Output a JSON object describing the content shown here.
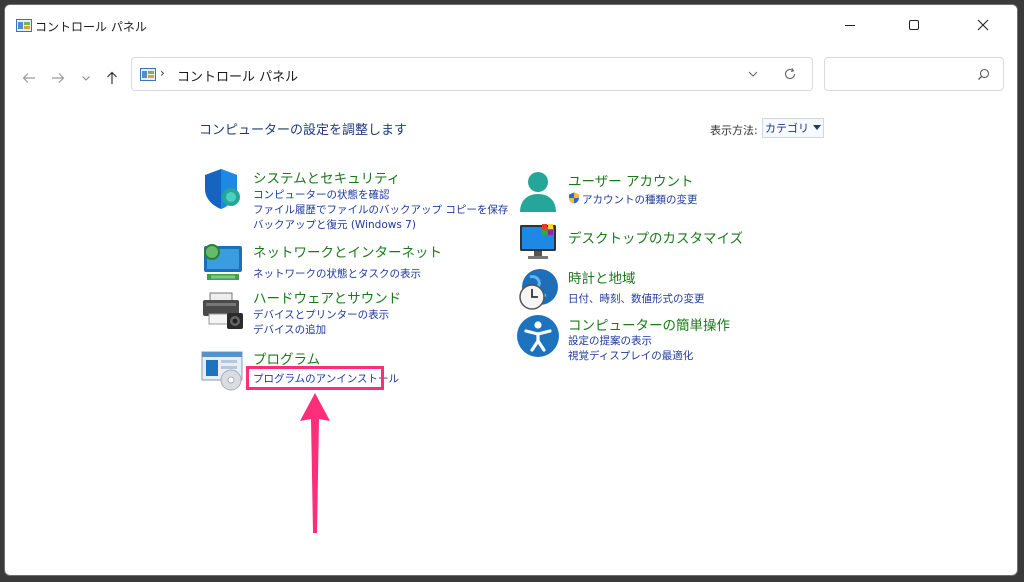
{
  "window": {
    "title": "コントロール パネル",
    "controls": {
      "minimize": "—",
      "maximize": "□",
      "close": "✕"
    }
  },
  "nav": {
    "breadcrumb_sep": "›",
    "address": "コントロール パネル",
    "search_placeholder": ""
  },
  "main": {
    "heading": "コンピューターの設定を調整します",
    "view_by_label": "表示方法:",
    "view_by_value": "カテゴリ"
  },
  "categories": [
    {
      "title": "システムとセキュリティ",
      "links": [
        "コンピューターの状態を確認",
        "ファイル履歴でファイルのバックアップ コピーを保存",
        "バックアップと復元 (Windows 7)"
      ],
      "icon": "shield-icon"
    },
    {
      "title": "ネットワークとインターネット",
      "links": [
        "ネットワークの状態とタスクの表示"
      ],
      "icon": "network-icon"
    },
    {
      "title": "ハードウェアとサウンド",
      "links": [
        "デバイスとプリンターの表示",
        "デバイスの追加"
      ],
      "icon": "printer-icon"
    },
    {
      "title": "プログラム",
      "links": [
        "プログラムのアンインストール"
      ],
      "icon": "programs-icon"
    },
    {
      "title": "ユーザー アカウント",
      "links": [
        "アカウントの種類の変更"
      ],
      "icon": "user-icon"
    },
    {
      "title": "デスクトップのカスタマイズ",
      "links": [],
      "icon": "monitor-icon"
    },
    {
      "title": "時計と地域",
      "links": [
        "日付、時刻、数値形式の変更"
      ],
      "icon": "clock-globe-icon"
    },
    {
      "title": "コンピューターの簡単操作",
      "links": [
        "設定の提案の表示",
        "視覚ディスプレイの最適化"
      ],
      "icon": "accessibility-icon"
    }
  ],
  "colors": {
    "category_title": "#1a7a1a",
    "link": "#1e3a9a",
    "heading": "#1e3a78",
    "highlight": "#ff2d7a"
  }
}
